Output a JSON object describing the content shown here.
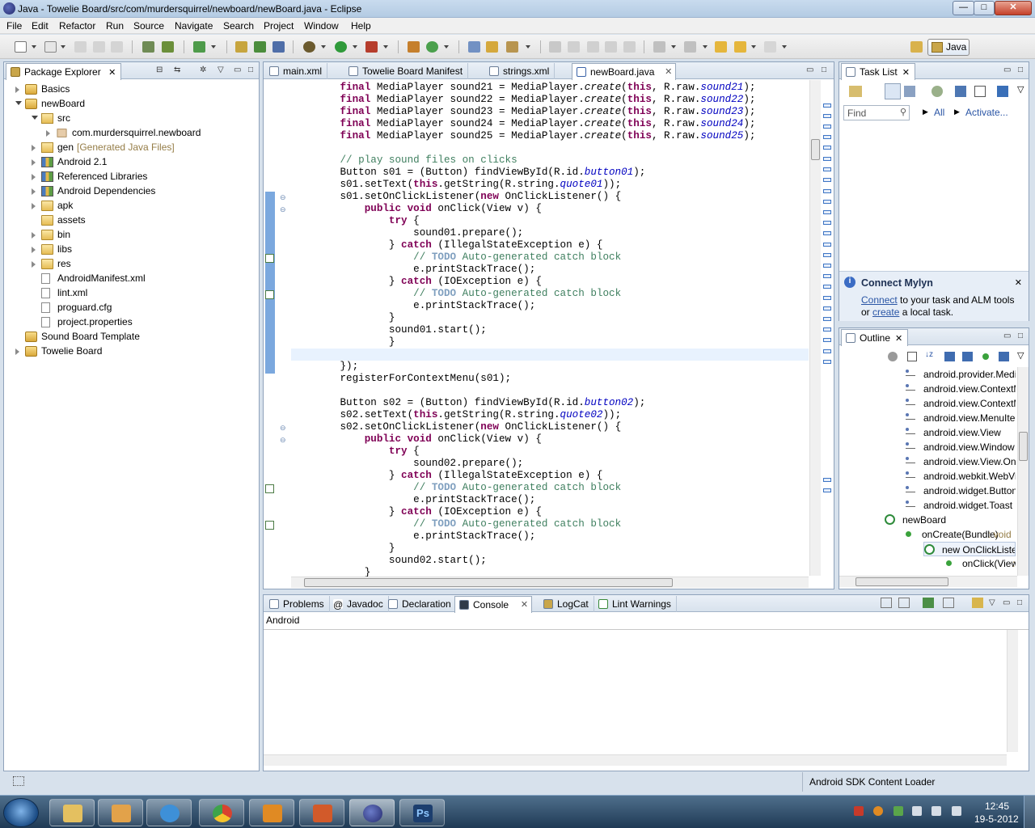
{
  "window": {
    "title": "Java - Towelie Board/src/com/murdersquirrel/newboard/newBoard.java - Eclipse",
    "minimize": "—",
    "maximize": "□",
    "close": "✕"
  },
  "menu": [
    "File",
    "Edit",
    "Refactor",
    "Run",
    "Source",
    "Navigate",
    "Search",
    "Project",
    "Window",
    "Help"
  ],
  "perspective": {
    "label": "Java"
  },
  "package_explorer": {
    "title": "Package Explorer",
    "items": [
      {
        "label": "Basics",
        "depth": 0,
        "icon": "project-icon",
        "expand": "collapsed"
      },
      {
        "label": "newBoard",
        "depth": 0,
        "icon": "project-icon",
        "expand": "expanded"
      },
      {
        "label": "src",
        "depth": 1,
        "icon": "source-folder-icon",
        "expand": "expanded"
      },
      {
        "label": "com.murdersquirrel.newboard",
        "depth": 2,
        "icon": "package-icon",
        "expand": "collapsed"
      },
      {
        "label": "gen",
        "suffix": "[Generated Java Files]",
        "depth": 1,
        "icon": "source-folder-icon",
        "expand": "collapsed"
      },
      {
        "label": "Android 2.1",
        "depth": 1,
        "icon": "library-icon",
        "expand": "collapsed"
      },
      {
        "label": "Referenced Libraries",
        "depth": 1,
        "icon": "library-icon",
        "expand": "collapsed"
      },
      {
        "label": "Android Dependencies",
        "depth": 1,
        "icon": "library-icon",
        "expand": "collapsed"
      },
      {
        "label": "apk",
        "depth": 1,
        "icon": "folder-icon",
        "expand": "collapsed"
      },
      {
        "label": "assets",
        "depth": 1,
        "icon": "folder-icon",
        "expand": "none"
      },
      {
        "label": "bin",
        "depth": 1,
        "icon": "folder-icon",
        "expand": "collapsed"
      },
      {
        "label": "libs",
        "depth": 1,
        "icon": "folder-icon",
        "expand": "collapsed"
      },
      {
        "label": "res",
        "depth": 1,
        "icon": "folder-icon",
        "expand": "collapsed"
      },
      {
        "label": "AndroidManifest.xml",
        "depth": 1,
        "icon": "xml-file-icon",
        "expand": "none"
      },
      {
        "label": "lint.xml",
        "depth": 1,
        "icon": "xml-file-icon",
        "expand": "none"
      },
      {
        "label": "proguard.cfg",
        "depth": 1,
        "icon": "file-icon",
        "expand": "none"
      },
      {
        "label": "project.properties",
        "depth": 1,
        "icon": "file-icon",
        "expand": "none"
      },
      {
        "label": "Sound Board Template",
        "depth": 0,
        "icon": "project-icon",
        "expand": "none"
      },
      {
        "label": "Towelie Board",
        "depth": 0,
        "icon": "project-icon",
        "expand": "collapsed"
      }
    ]
  },
  "editor_tabs": [
    {
      "label": "main.xml"
    },
    {
      "label": "Towelie Board Manifest"
    },
    {
      "label": "strings.xml"
    },
    {
      "label": "newBoard.java",
      "active": true
    }
  ],
  "code_lines": [
    [
      {
        "t": "        "
      },
      {
        "t": "final",
        "c": "kw"
      },
      {
        "t": " MediaPlayer sound21 = MediaPlayer."
      },
      {
        "t": "create",
        "c": "mth"
      },
      {
        "t": "("
      },
      {
        "t": "this",
        "c": "kw"
      },
      {
        "t": ", R.raw."
      },
      {
        "t": "sound21",
        "c": "fld"
      },
      {
        "t": ");"
      }
    ],
    [
      {
        "t": "        "
      },
      {
        "t": "final",
        "c": "kw"
      },
      {
        "t": " MediaPlayer sound22 = MediaPlayer."
      },
      {
        "t": "create",
        "c": "mth"
      },
      {
        "t": "("
      },
      {
        "t": "this",
        "c": "kw"
      },
      {
        "t": ", R.raw."
      },
      {
        "t": "sound22",
        "c": "fld"
      },
      {
        "t": ");"
      }
    ],
    [
      {
        "t": "        "
      },
      {
        "t": "final",
        "c": "kw"
      },
      {
        "t": " MediaPlayer sound23 = MediaPlayer."
      },
      {
        "t": "create",
        "c": "mth"
      },
      {
        "t": "("
      },
      {
        "t": "this",
        "c": "kw"
      },
      {
        "t": ", R.raw."
      },
      {
        "t": "sound23",
        "c": "fld"
      },
      {
        "t": ");"
      }
    ],
    [
      {
        "t": "        "
      },
      {
        "t": "final",
        "c": "kw"
      },
      {
        "t": " MediaPlayer sound24 = MediaPlayer."
      },
      {
        "t": "create",
        "c": "mth"
      },
      {
        "t": "("
      },
      {
        "t": "this",
        "c": "kw"
      },
      {
        "t": ", R.raw."
      },
      {
        "t": "sound24",
        "c": "fld"
      },
      {
        "t": ");"
      }
    ],
    [
      {
        "t": "        "
      },
      {
        "t": "final",
        "c": "kw"
      },
      {
        "t": " MediaPlayer sound25 = MediaPlayer."
      },
      {
        "t": "create",
        "c": "mth"
      },
      {
        "t": "("
      },
      {
        "t": "this",
        "c": "kw"
      },
      {
        "t": ", R.raw."
      },
      {
        "t": "sound25",
        "c": "fld"
      },
      {
        "t": ");"
      }
    ],
    [],
    [
      {
        "t": "        "
      },
      {
        "t": "// play sound files on clicks",
        "c": "cm"
      }
    ],
    [
      {
        "t": "        Button s01 = (Button) findViewById(R.id."
      },
      {
        "t": "button01",
        "c": "fld"
      },
      {
        "t": ");"
      }
    ],
    [
      {
        "t": "        s01.setText("
      },
      {
        "t": "this",
        "c": "kw"
      },
      {
        "t": ".getString(R.string."
      },
      {
        "t": "quote01",
        "c": "fld"
      },
      {
        "t": "));"
      }
    ],
    [
      {
        "t": "        s01.setOnClickListener("
      },
      {
        "t": "new",
        "c": "kw"
      },
      {
        "t": " OnClickListener() {"
      }
    ],
    [
      {
        "t": "            "
      },
      {
        "t": "public",
        "c": "kw"
      },
      {
        "t": " "
      },
      {
        "t": "void",
        "c": "kw"
      },
      {
        "t": " onClick(View v) {"
      }
    ],
    [
      {
        "t": "                "
      },
      {
        "t": "try",
        "c": "kw"
      },
      {
        "t": " {"
      }
    ],
    [
      {
        "t": "                    sound01.prepare();"
      }
    ],
    [
      {
        "t": "                } "
      },
      {
        "t": "catch",
        "c": "kw"
      },
      {
        "t": " (IllegalStateException e) {"
      }
    ],
    [
      {
        "t": "                    "
      },
      {
        "t": "// ",
        "c": "cm"
      },
      {
        "t": "TODO",
        "c": "todo"
      },
      {
        "t": " Auto-generated catch block",
        "c": "cm"
      }
    ],
    [
      {
        "t": "                    e.printStackTrace();"
      }
    ],
    [
      {
        "t": "                } "
      },
      {
        "t": "catch",
        "c": "kw"
      },
      {
        "t": " (IOException e) {"
      }
    ],
    [
      {
        "t": "                    "
      },
      {
        "t": "// ",
        "c": "cm"
      },
      {
        "t": "TODO",
        "c": "todo"
      },
      {
        "t": " Auto-generated catch block",
        "c": "cm"
      }
    ],
    [
      {
        "t": "                    e.printStackTrace();"
      }
    ],
    [
      {
        "t": "                }"
      }
    ],
    [
      {
        "t": "                sound01.start();"
      }
    ],
    [
      {
        "t": "                }"
      }
    ],
    [],
    [
      {
        "t": "        });"
      }
    ],
    [
      {
        "t": "        registerForContextMenu(s01);"
      }
    ],
    [],
    [
      {
        "t": "        Button s02 = (Button) findViewById(R.id."
      },
      {
        "t": "button02",
        "c": "fld"
      },
      {
        "t": ");"
      }
    ],
    [
      {
        "t": "        s02.setText("
      },
      {
        "t": "this",
        "c": "kw"
      },
      {
        "t": ".getString(R.string."
      },
      {
        "t": "quote02",
        "c": "fld"
      },
      {
        "t": "));"
      }
    ],
    [
      {
        "t": "        s02.setOnClickListener("
      },
      {
        "t": "new",
        "c": "kw"
      },
      {
        "t": " OnClickListener() {"
      }
    ],
    [
      {
        "t": "            "
      },
      {
        "t": "public",
        "c": "kw"
      },
      {
        "t": " "
      },
      {
        "t": "void",
        "c": "kw"
      },
      {
        "t": " onClick(View v) {"
      }
    ],
    [
      {
        "t": "                "
      },
      {
        "t": "try",
        "c": "kw"
      },
      {
        "t": " {"
      }
    ],
    [
      {
        "t": "                    sound02.prepare();"
      }
    ],
    [
      {
        "t": "                } "
      },
      {
        "t": "catch",
        "c": "kw"
      },
      {
        "t": " (IllegalStateException e) {"
      }
    ],
    [
      {
        "t": "                    "
      },
      {
        "t": "// ",
        "c": "cm"
      },
      {
        "t": "TODO",
        "c": "todo"
      },
      {
        "t": " Auto-generated catch block",
        "c": "cm"
      }
    ],
    [
      {
        "t": "                    e.printStackTrace();"
      }
    ],
    [
      {
        "t": "                } "
      },
      {
        "t": "catch",
        "c": "kw"
      },
      {
        "t": " (IOException e) {"
      }
    ],
    [
      {
        "t": "                    "
      },
      {
        "t": "// ",
        "c": "cm"
      },
      {
        "t": "TODO",
        "c": "todo"
      },
      {
        "t": " Auto-generated catch block",
        "c": "cm"
      }
    ],
    [
      {
        "t": "                    e.printStackTrace();"
      }
    ],
    [
      {
        "t": "                }"
      }
    ],
    [
      {
        "t": "                sound02.start();"
      }
    ],
    [
      {
        "t": "            }"
      }
    ]
  ],
  "task_list": {
    "title": "Task List",
    "find_placeholder": "Find",
    "all": "All",
    "activate": "Activate..."
  },
  "mylyn": {
    "title": "Connect Mylyn",
    "connect": "Connect",
    "text1": " to your task and ALM tools",
    "or": "or ",
    "create": "create",
    "text2": " a local task."
  },
  "outline": {
    "title": "Outline",
    "items": [
      {
        "label": "android.provider.MediaStore",
        "kind": "import"
      },
      {
        "label": "android.view.ContextMenu",
        "kind": "import"
      },
      {
        "label": "android.view.ContextMenu",
        "kind": "import"
      },
      {
        "label": "android.view.MenuItem",
        "kind": "import"
      },
      {
        "label": "android.view.View",
        "kind": "import"
      },
      {
        "label": "android.view.Window",
        "kind": "import"
      },
      {
        "label": "android.view.View.OnClickListener",
        "kind": "import"
      },
      {
        "label": "android.webkit.WebView",
        "kind": "import"
      },
      {
        "label": "android.widget.Button",
        "kind": "import"
      },
      {
        "label": "android.widget.Toast",
        "kind": "import"
      },
      {
        "label": "newBoard",
        "kind": "class"
      },
      {
        "label": "onCreate(Bundle)",
        "suffix": " : void",
        "kind": "method"
      },
      {
        "label": "new OnClickListener()",
        "kind": "anon"
      },
      {
        "label": "onClick(View)",
        "suffix": " : void",
        "kind": "method2"
      }
    ]
  },
  "bottom_tabs": [
    {
      "label": "Problems"
    },
    {
      "label": "Javadoc"
    },
    {
      "label": "Declaration"
    },
    {
      "label": "Console",
      "active": true
    },
    {
      "label": "LogCat"
    },
    {
      "label": "Lint Warnings"
    }
  ],
  "console": {
    "header": "Android"
  },
  "status": {
    "right": "Android SDK Content Loader"
  },
  "clock": {
    "time": "12:45",
    "date": "19-5-2012"
  }
}
